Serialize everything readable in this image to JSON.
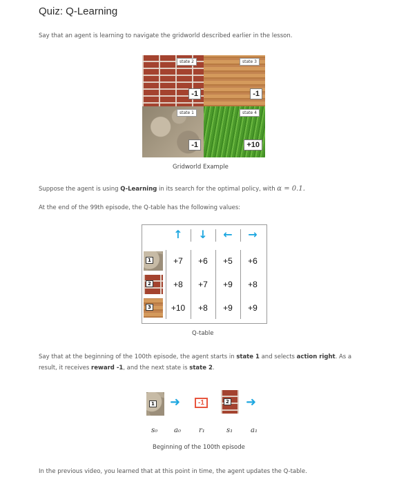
{
  "title": "Quiz: Q-Learning",
  "intro": "Say that an agent is learning to navigate the gridworld described earlier in the lesson.",
  "gridworld": {
    "caption": "Gridworld Example",
    "cells": [
      {
        "label": "state 2",
        "reward": "-1"
      },
      {
        "label": "state 3",
        "reward": "-1"
      },
      {
        "label": "state 1",
        "reward": "-1"
      },
      {
        "label": "state 4",
        "reward": "+10"
      }
    ]
  },
  "para2": {
    "pre": "Suppose the agent is using ",
    "bold": "Q-Learning",
    "post": " in its search for the optimal policy, with ",
    "math": "α = 0.1."
  },
  "para3": "At the end of the 99th episode, the Q-table has the following values:",
  "qtable": {
    "caption": "Q-table",
    "headers": [
      "↑",
      "↓",
      "←",
      "→"
    ],
    "rows": [
      {
        "state": "1",
        "values": [
          "+7",
          "+6",
          "+5",
          "+6"
        ]
      },
      {
        "state": "2",
        "values": [
          "+8",
          "+7",
          "+9",
          "+8"
        ]
      },
      {
        "state": "3",
        "values": [
          "+10",
          "+8",
          "+9",
          "+9"
        ]
      }
    ]
  },
  "para4": {
    "t1": "Say that at the beginning of the 100th episode, the agent starts in ",
    "b1": "state 1",
    "t2": " and selects ",
    "b2": "action right",
    "t3": ". As a",
    "line2_t1": "result, it receives ",
    "line2_b1": "reward -1",
    "line2_t2": ", and the next state is ",
    "line2_b2": "state 2",
    "line2_t3": "."
  },
  "episode": {
    "caption": "Beginning of the 100th episode",
    "s0_tag": "1",
    "reward": "-1",
    "s1_tag": "2",
    "symbols": [
      "s0",
      "a0",
      "r1",
      "s1",
      "a1"
    ],
    "symbol_display": [
      "s₀",
      "a₀",
      "r₁",
      "s₁",
      "a₁"
    ]
  },
  "para5": "In the previous video, you learned that at this point in time, the agent updates the Q-table."
}
